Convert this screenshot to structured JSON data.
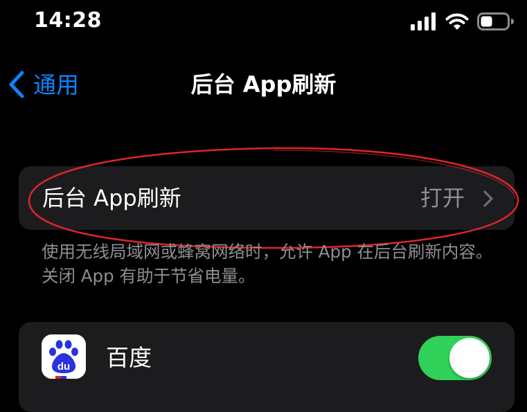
{
  "status_bar": {
    "time": "14:28",
    "signal_icon": "cellular-signal-icon",
    "wifi_icon": "wifi-icon",
    "battery_icon": "battery-icon"
  },
  "nav": {
    "back_label": "通用",
    "back_icon": "chevron-left-icon",
    "title": "后台 App刷新"
  },
  "main_setting": {
    "label": "后台 App刷新",
    "value": "打开",
    "chevron_icon": "chevron-right-icon"
  },
  "footer": {
    "text": "使用无线局域网或蜂窝网络时，允许 App 在后台刷新内容。关闭 App 有助于节省电量。"
  },
  "apps": [
    {
      "name": "百度",
      "icon": "baidu-app-icon",
      "icon_text": "du",
      "enabled": true
    }
  ],
  "colors": {
    "background": "#000000",
    "group_background": "#1c1c1e",
    "accent": "#0a84ff",
    "secondary_text": "#8e8e93",
    "toggle_on": "#30d158",
    "annotation": "#e0242c",
    "baidu_blue": "#2932e1"
  }
}
